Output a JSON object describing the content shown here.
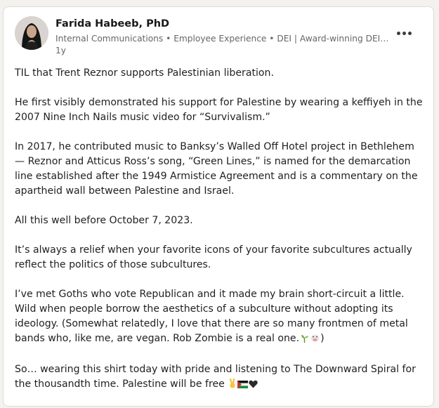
{
  "post": {
    "author": {
      "name": "Farida Habeeb, PhD",
      "headline": "Internal Communications • Employee Experience • DEI | Award-winning DEI …",
      "time": "1y",
      "avatar_icon": "profile-photo"
    },
    "menu_icon": "more-options-icon",
    "paragraphs": [
      "TIL that Trent Reznor supports Palestinian liberation.",
      "He first visibly demonstrated his support for Palestine by wearing a keffiyeh in the 2007 Nine Inch Nails music video for “Survivalism.”",
      "In 2017, he contributed music to Banksy’s Walled Off Hotel project in Bethlehem — Reznor and Atticus Ross’s song, “Green Lines,” is named for the demarcation line established after the 1949 Armistice Agreement and is a commentary on the apartheid wall between Palestine and Israel.",
      "All this well before October 7, 2023.",
      "It’s always a relief when your favorite icons of your favorite subcultures actually reflect the politics of those subcultures.",
      "I’ve met Goths who vote Republican and it made my brain short-circuit a little. Wild when people borrow the aesthetics of a subculture without adopting its ideology. (Somewhat relatedly, I love that there are so many frontmen of metal bands who, like me, are vegan. Rob Zombie is a real one.",
      "So… wearing this shirt today with pride and listening to The Downward Spiral for the thousandth time. Palestine will be free"
    ],
    "paragraph6_suffix": ")",
    "emoji_icons": {
      "vegan": [
        "seedling-icon",
        "cow-icon"
      ],
      "closing": [
        "victory-hand-icon",
        "palestine-flag-icon",
        "black-heart-icon"
      ]
    }
  }
}
